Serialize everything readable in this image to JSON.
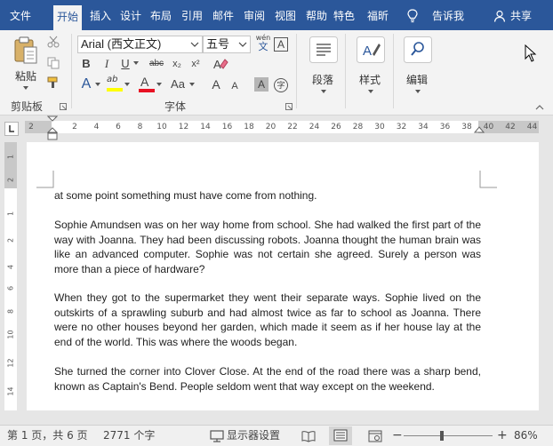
{
  "tabs": [
    {
      "label": "文件"
    },
    {
      "label": "开始"
    },
    {
      "label": "插入"
    },
    {
      "label": "设计"
    },
    {
      "label": "布局"
    },
    {
      "label": "引用"
    },
    {
      "label": "邮件"
    },
    {
      "label": "审阅"
    },
    {
      "label": "视图"
    },
    {
      "label": "帮助"
    },
    {
      "label": "特色"
    },
    {
      "label": "福昕"
    }
  ],
  "tell_me": "告诉我",
  "share": "共享",
  "clipboard": {
    "paste": "粘贴",
    "group": "剪贴板"
  },
  "font": {
    "name": "Arial (西文正文)",
    "size": "五号",
    "wen": "wén",
    "wen_char": "文",
    "boxed_a": "A",
    "bold": "B",
    "italic": "I",
    "underline": "U",
    "strike": "abc",
    "subscript": "x₂",
    "superscript": "x²",
    "text_effects": "A",
    "highlight": "ab",
    "font_color": "A",
    "change_case": "Aa",
    "grow": "A",
    "shrink": "A",
    "shading": "A",
    "enclose": "字",
    "group": "字体"
  },
  "paragraph": {
    "label": "段落"
  },
  "styles": {
    "label": "样式"
  },
  "editing": {
    "label": "编辑"
  },
  "ruler_numbers": [
    "2",
    "2",
    "4",
    "6",
    "8",
    "10",
    "12",
    "14",
    "16",
    "18",
    "20",
    "22",
    "24",
    "26",
    "28",
    "30",
    "32",
    "34",
    "36",
    "38",
    "40",
    "42",
    "44"
  ],
  "vruler_numbers": [
    "1",
    "2",
    "1",
    "2",
    "4",
    "6",
    "8",
    "10",
    "12",
    "14"
  ],
  "document": {
    "paragraphs": [
      "at some point something must have come from nothing.",
      "Sophie Amundsen was on her way home from school. She had walked the first part of the way with Joanna. They had been discussing robots. Joanna thought the human brain was like an advanced computer. Sophie was not certain she agreed. Surely a person was more than a piece of hardware?",
      "When they got to the supermarket they went their separate ways. Sophie lived on the outskirts of a sprawling suburb and had almost twice as far to school as Joanna. There were no other houses beyond her garden, which made it seem as if her house lay at the end of the world. This was where the woods began.",
      "She turned the corner into Clover Close. At the end of the road there was a sharp bend, known as Captain's Bend. People seldom went that way except on the weekend."
    ]
  },
  "status": {
    "page": "第 1 页，共 6 页",
    "words": "2771 个字",
    "display_settings": "显示器设置",
    "zoom_minus": "−",
    "zoom_plus": "+",
    "zoom": "86%"
  },
  "colors": {
    "accent": "#2b579a",
    "highlight": "#ffff00",
    "font_color": "#e81123"
  }
}
